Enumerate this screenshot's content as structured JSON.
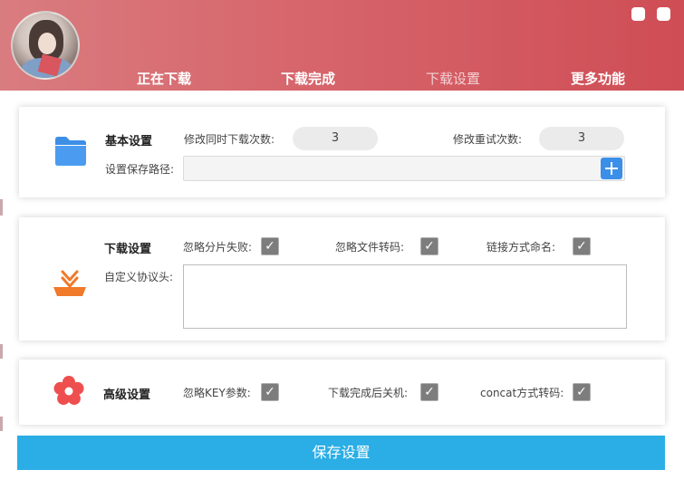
{
  "nav": {
    "downloading": "正在下载",
    "completed": "下载完成",
    "settings": "下载设置",
    "more": "更多功能"
  },
  "basic": {
    "title": "基本设置",
    "concurrent_label": "修改同时下载次数:",
    "concurrent_value": "3",
    "retry_label": "修改重试次数:",
    "retry_value": "3",
    "path_label": "设置保存路径:",
    "path_value": ""
  },
  "download": {
    "title": "下载设置",
    "ignore_fragment_fail": "忽略分片失败:",
    "ignore_file_transcode": "忽略文件转码:",
    "link_naming": "链接方式命名:",
    "custom_header_label": "自定义协议头:",
    "custom_header_value": ""
  },
  "advanced": {
    "title": "高级设置",
    "ignore_key": "忽略KEY参数:",
    "shutdown_after": "下载完成后关机:",
    "concat_transcode": "concat方式转码:"
  },
  "save_button": "保存设置",
  "colors": {
    "header_start": "#d97c80",
    "header_end": "#cf4d55",
    "accent_blue": "#3b8fe8",
    "save_blue": "#2aaee5",
    "download_icon_orange": "#f0792a",
    "flower_red": "#ef4e4e"
  },
  "icons": {
    "basic": "folder-icon",
    "download": "download-tray-icon",
    "advanced": "flower-icon",
    "add": "plus-icon",
    "check": "checkmark-icon"
  }
}
